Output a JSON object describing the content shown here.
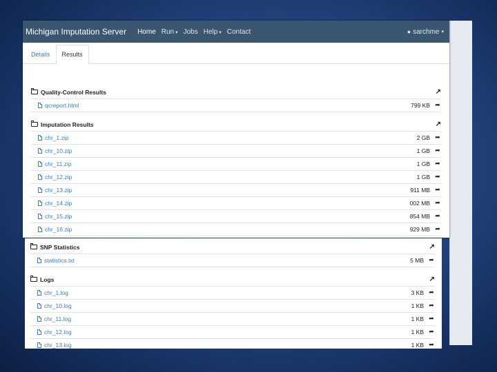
{
  "navbar": {
    "brand": "Michigan Imputation Server",
    "items": [
      "Home",
      "Run",
      "Jobs",
      "Help",
      "Contact"
    ],
    "user": "sarchme"
  },
  "tabs": [
    "Details",
    "Results"
  ],
  "sections": [
    {
      "title": "Quality-Control Results",
      "files": [
        {
          "name": "qcreport.html",
          "size": "799 KB"
        }
      ]
    },
    {
      "title": "Imputation Results",
      "files": [
        {
          "name": "chr_1.zip",
          "size": "2 GB"
        },
        {
          "name": "chr_10.zip",
          "size": "1 GB"
        },
        {
          "name": "chr_11.zip",
          "size": "1 GB"
        },
        {
          "name": "chr_12.zip",
          "size": "1 GB"
        },
        {
          "name": "chr_13.zip",
          "size": "911 MB"
        },
        {
          "name": "chr_14.zip",
          "size": "002 MB"
        },
        {
          "name": "chr_15.zip",
          "size": "854 MB"
        },
        {
          "name": "chr_16.zip",
          "size": "929 MB"
        }
      ]
    },
    {
      "title": "SNP Statistics",
      "files": [
        {
          "name": "statistics.txt",
          "size": "5 MB"
        }
      ]
    },
    {
      "title": "Logs",
      "files": [
        {
          "name": "chr_1.log",
          "size": "3 KB"
        },
        {
          "name": "chr_10.log",
          "size": "1 KB"
        },
        {
          "name": "chr_11.log",
          "size": "1 KB"
        },
        {
          "name": "chr_12.log",
          "size": "1 KB"
        },
        {
          "name": "chr_13.log",
          "size": "1 KB"
        }
      ]
    }
  ]
}
